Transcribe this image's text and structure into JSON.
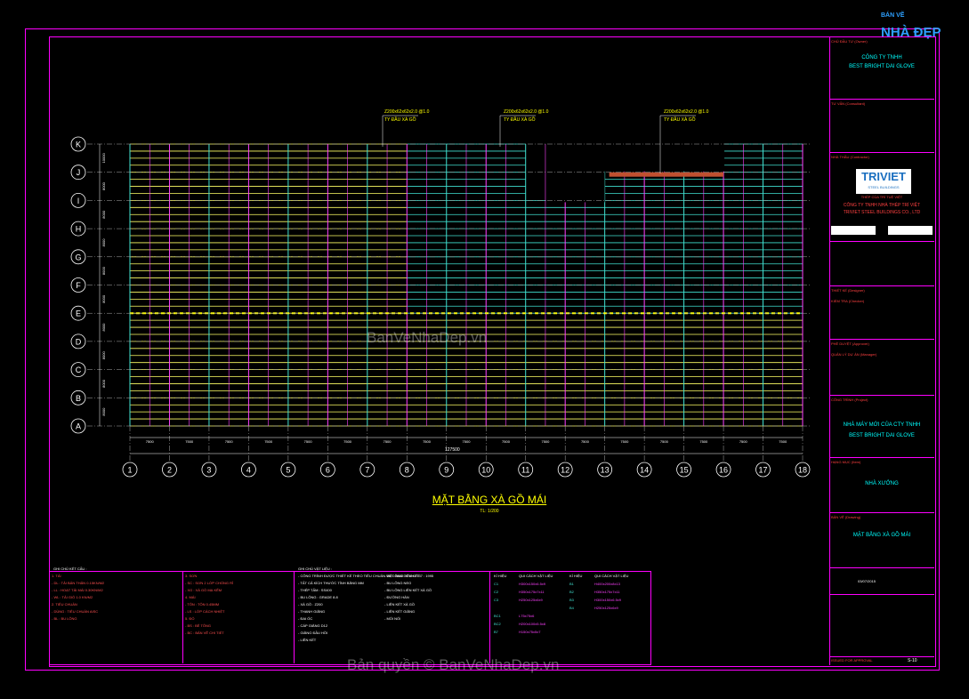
{
  "watermark_top": "BÁN VẼ",
  "watermark_logo": "NHÀ ĐẸP",
  "watermark_center": "BanVeNhaDep.vn",
  "watermark_bottom": "Bản quyền © BanVeNhaDep.vn",
  "drawing_title": "MẶT BẰNG XÀ GỒ MÁI",
  "drawing_scale": "TL: 1/200",
  "grid_rows": [
    "K",
    "J",
    "I",
    "H",
    "G",
    "F",
    "E",
    "D",
    "C",
    "B",
    "A"
  ],
  "grid_cols": [
    "1",
    "2",
    "3",
    "4",
    "5",
    "6",
    "7",
    "8",
    "9",
    "10",
    "11",
    "12",
    "13",
    "14",
    "15",
    "16",
    "17",
    "18"
  ],
  "bay_spacings": [
    "7500",
    "7500",
    "7500",
    "7500",
    "7500",
    "7500",
    "7500",
    "7500",
    "7500",
    "7500",
    "7500",
    "7500",
    "7500",
    "7500",
    "7500",
    "7500",
    "7500"
  ],
  "overall_dim": "127500",
  "row_dims": [
    "10000",
    "8000",
    "8000",
    "8000",
    "8000",
    "8000",
    "8000",
    "8000",
    "8000",
    "8000"
  ],
  "callouts": [
    "Z200x62x62x2.0 @1.0",
    "Z200x62x62x2.0 @1.0",
    "Z200x62x62x2.0 @1.0"
  ],
  "callout_subs": [
    "TY ĐẦU XÀ GỒ",
    "TY ĐẦU XÀ GỒ",
    "TY ĐẦU XÀ GỒ"
  ],
  "title_block": {
    "owner_label": "CHỦ ĐẦU TƯ (Owner)",
    "owner": "CÔNG TY TNHH",
    "owner2": "BEST BRIGHT DAI GLOVE",
    "consultant_label": "TƯ VẤN (Consultant)",
    "contractor_label": "NHÀ THẦU (Contractor)",
    "company_logo": "TRIVIET",
    "company_logo_sub": "STEEL BUILDINGS",
    "company_tag": "THÉP CỦA TRÍ TUỆ VIỆT",
    "company_vn": "CÔNG TY TNHH NHÀ THÉP TRÍ VIỆT",
    "company_en": "TRIVIET STEEL BUILDINGS CO., LTD",
    "designer_label": "THIẾT KẾ (Designer)",
    "checker_label": "KIỂM TRA (Checker)",
    "approver_label": "PHÊ DUYỆT (Approver)",
    "manager_label": "QUẢN LÝ DỰ ÁN (Manager)",
    "project_label": "CÔNG TRÌNH (Project)",
    "project": "NHÀ MÁY MỚI CỦA CTY TNHH",
    "project2": "BEST BRIGHT DAI GLOVE",
    "item_label": "HẠNG MỤC (Item)",
    "item": "NHÀ XƯỞNG",
    "drawing_label": "BẢN VẼ (Drawing)",
    "drawing": "MẶT BẰNG XÀ GỒ MÁI",
    "rev_date": "03/07/2015",
    "sheet_no": "ISSUED FOR APPROVAL",
    "drawing_no": "S-10"
  },
  "notes": {
    "general_title": "GHI CHÚ KẾT CẤU :",
    "steel_title": "GHI CHÚ VẬT LIỆU :",
    "col1": [
      "1. TẢI",
      "- DL : TẢI BẢN THÂN 0.15KN/M2",
      "- LL : HOẠT TẢI MÁI 0.30KN/M2",
      "- WL : TẢI GIÓ 1.0 KN/M2",
      "2. TIÊU CHUẨN",
      "- DÙNG : TIÊU CHUẨN AISC",
      "- BL : BU LÔNG"
    ],
    "col2": [
      "3. SƠN",
      "- SC : SƠN 2 LỚP CHỐNG RỈ",
      "- XG : XÀ GỒ MẠ KẼM",
      "4. MÁI",
      "- TÔN : TÔN 0.45MM",
      "- LS : LỚP CÁCH NHIỆT",
      "5. ĐỔ",
      "- BS : BÊ TÔNG",
      "- BC : BẢN VẼ CHI TIẾT"
    ],
    "col3": [
      "- CÔNG TRÌNH ĐƯỢC THIẾT KẾ THEO TIÊU CHUẨN VIỆT NAM TCVN 2737 : 1995",
      "- TẤT CẢ KÍCH THƯỚC TÍNH BẰNG MM",
      "- THÉP TẤM : SS400",
      "- BU LÔNG : GRADE 8.8",
      "- XÀ GỒ : Z200",
      "- THANH GIẰNG",
      "- ĐAI ỐC",
      "- CÁP GIẰNG D12",
      "- GIẰNG ĐẦU HỒI",
      "- LIÊN KẾT"
    ],
    "col4": [
      "- BU LÔNG LIÊN KẾT",
      "- BU LÔNG NEO",
      "- BU LÔNG LIÊN KẾT XÀ GỒ",
      "- ĐƯỜNG HÀN",
      "- LIÊN KẾT XÀ GỒ",
      "- LIÊN KẾT GIẰNG",
      "- MỐI NỐI"
    ],
    "mat_head": [
      "KÍ HIỆU",
      "QUI CÁCH VẬT LIỆU",
      "KÍ HIỆU",
      "QUI CÁCH VẬT LIỆU"
    ],
    "mat_rows": [
      [
        "C1",
        "H300x150x6.5x9",
        "B1",
        "H400x200x8x13"
      ],
      [
        "C2",
        "H350x175x7x11",
        "B2",
        "H350x175x7x11"
      ],
      [
        "C3",
        "H250x125x6x9",
        "B3",
        "H300x150x6.5x9"
      ],
      [
        "",
        "",
        "B4",
        "H250x125x6x9"
      ],
      [
        "BC1",
        "L75x75x6",
        "",
        ""
      ],
      [
        "BC2",
        "H200x100x5.5x8",
        "",
        ""
      ],
      [
        "B7",
        "H150x75x5x7",
        "",
        ""
      ]
    ]
  }
}
